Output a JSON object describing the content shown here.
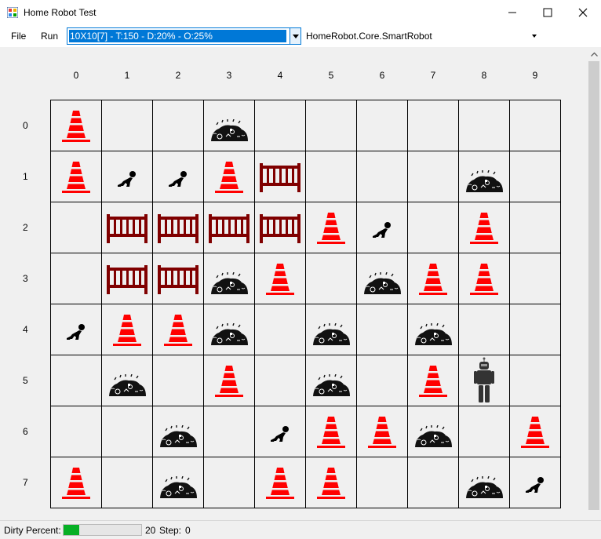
{
  "window": {
    "title": "Home Robot Test",
    "controls": [
      "minimize",
      "maximize",
      "close"
    ]
  },
  "menu": {
    "file": "File",
    "run": "Run"
  },
  "toolbar": {
    "map_select_value": "10X10[7] - T:150 - D:20% - O:25%",
    "robot_select_value": "HomeRobot.Core.SmartRobot"
  },
  "grid": {
    "columns": [
      "0",
      "1",
      "2",
      "3",
      "4",
      "5",
      "6",
      "7",
      "8",
      "9"
    ],
    "rows": [
      "0",
      "1",
      "2",
      "3",
      "4",
      "5",
      "6",
      "7"
    ],
    "legend_icons": {
      "C": "traffic-cone-icon",
      "D": "dirt-pile-icon",
      "B": "crawling-baby-icon",
      "F": "crib-fence-icon",
      "R": "robot-icon"
    },
    "cells": [
      [
        "C",
        "",
        "",
        "D",
        "",
        "",
        "",
        "",
        "",
        ""
      ],
      [
        "C",
        "B",
        "B",
        "C",
        "F",
        "",
        "",
        "",
        "D",
        ""
      ],
      [
        "",
        "F",
        "F",
        "F",
        "F",
        "C",
        "B",
        "",
        "C",
        ""
      ],
      [
        "",
        "F",
        "F",
        "D",
        "C",
        "",
        "D",
        "C",
        "C",
        ""
      ],
      [
        "B",
        "C",
        "C",
        "D",
        "",
        "D",
        "",
        "D",
        "",
        ""
      ],
      [
        "",
        "D",
        "",
        "C",
        "",
        "D",
        "",
        "C",
        "R",
        ""
      ],
      [
        "",
        "",
        "D",
        "",
        "B",
        "C",
        "C",
        "D",
        "",
        "C"
      ],
      [
        "C",
        "",
        "D",
        "",
        "C",
        "C",
        "",
        "",
        "D",
        "B"
      ]
    ]
  },
  "status": {
    "dirty_label": "Dirty Percent:",
    "dirty_value": "20",
    "dirty_fraction": 0.2,
    "step_label": "Step:",
    "step_value": "0"
  },
  "colors": {
    "selection": "#0078d7",
    "progress": "#06b025",
    "cone": "#ff0000",
    "fence": "#800000",
    "grid_bg": "#f0f0f0"
  }
}
